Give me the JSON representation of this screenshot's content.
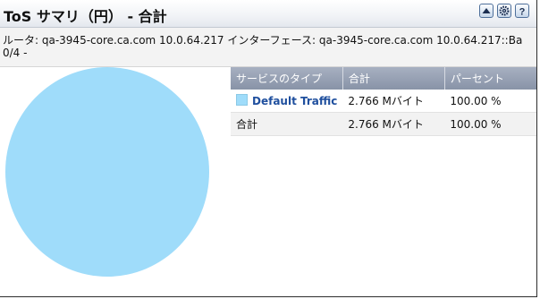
{
  "header": {
    "title": "ToS サマリ（円） - 合計",
    "buttons": [
      {
        "name": "collapse-button",
        "icon": "triangle-up-icon"
      },
      {
        "name": "settings-button",
        "icon": "gear-icon"
      },
      {
        "name": "help-button",
        "icon": "question-mark-icon",
        "glyph": "?"
      }
    ]
  },
  "subtitle": {
    "line1": "ルータ: qa-3945-core.ca.com 10.0.64.217 インターフェース: qa-3945-core.ca.com 10.0.64.217::Ba",
    "line2": "0/4 -"
  },
  "table": {
    "columns": [
      "サービスのタイプ",
      "合計",
      "パーセント"
    ],
    "rows": [
      {
        "service": "Default Traffic",
        "total": "2.766 Mバイト",
        "percent": "100.00 %",
        "color": "#9fdcfa"
      }
    ],
    "total_row": {
      "label": "合計",
      "total": "2.766 Mバイト",
      "percent": "100.00 %"
    }
  },
  "chart_data": {
    "type": "pie",
    "slices": [
      {
        "label": "Default Traffic",
        "value": 100,
        "color": "#9fdcfa"
      }
    ]
  },
  "colors": {
    "pie": "#9fdcfa",
    "link": "#1f4f9e",
    "header_bg": "#8893a7"
  }
}
